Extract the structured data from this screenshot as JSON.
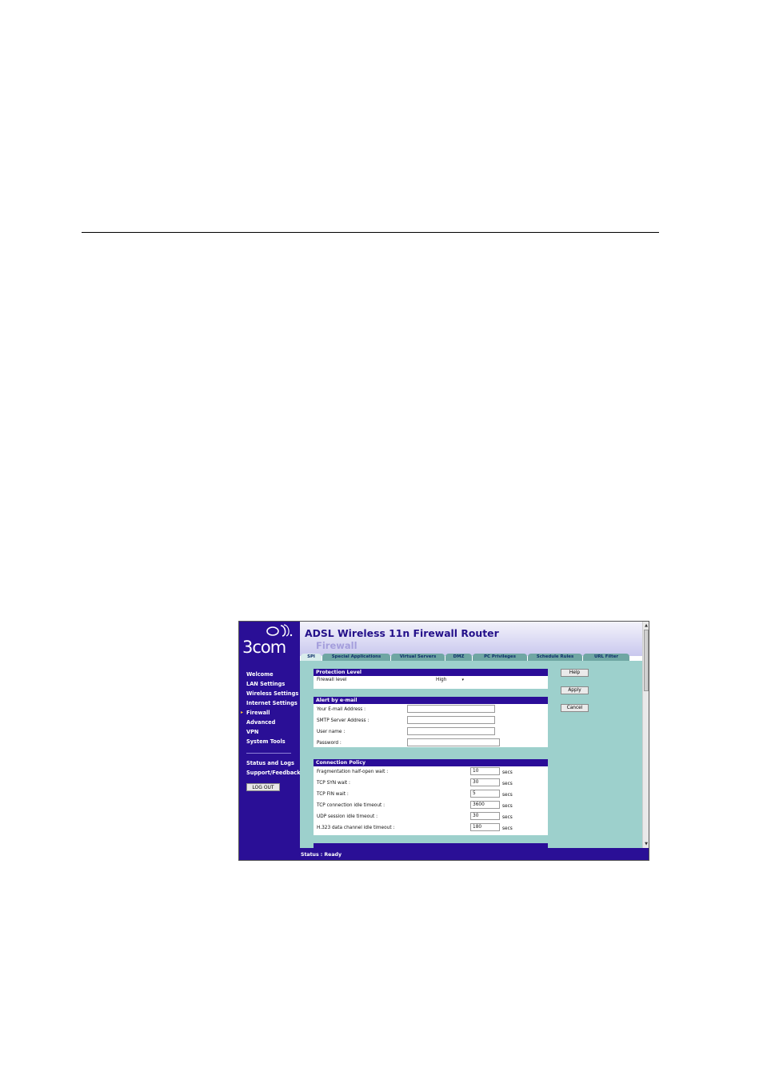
{
  "app": {
    "title": "ADSL Wireless 11n Firewall Router",
    "subtitle": "Firewall",
    "logo_text": "3com"
  },
  "sidebar": {
    "items": [
      {
        "label": "Welcome"
      },
      {
        "label": "LAN Settings"
      },
      {
        "label": "Wireless Settings"
      },
      {
        "label": "Internet Settings"
      },
      {
        "label": "Firewall",
        "active": true
      },
      {
        "label": "Advanced"
      },
      {
        "label": "VPN"
      },
      {
        "label": "System Tools"
      }
    ],
    "items2": [
      {
        "label": "Status and Logs"
      },
      {
        "label": "Support/Feedback"
      }
    ],
    "logout_label": "LOG OUT"
  },
  "tabs": [
    {
      "label": "SPI",
      "active": true
    },
    {
      "label": "Special Applications"
    },
    {
      "label": "Virtual Servers"
    },
    {
      "label": "DMZ"
    },
    {
      "label": "PC Privileges"
    },
    {
      "label": "Schedule Rules"
    },
    {
      "label": "URL Filter"
    }
  ],
  "protection": {
    "header": "Protection Level",
    "firewall_level_label": "Firewall level",
    "firewall_level_value": "High"
  },
  "alert": {
    "header": "Alert by e-mail",
    "email_label": "Your E-mail Address :",
    "smtp_label": "SMTP Server Address :",
    "username_label": "User name :",
    "password_label": "Password :"
  },
  "policy": {
    "header": "Connection Policy",
    "rows": [
      {
        "label": "Fragmentation half-open wait :",
        "value": "10",
        "unit": "secs"
      },
      {
        "label": "TCP SYN wait :",
        "value": "30",
        "unit": "secs"
      },
      {
        "label": "TCP FIN wait :",
        "value": "5",
        "unit": "secs"
      },
      {
        "label": "TCP connection idle timeout :",
        "value": "3600",
        "unit": "secs"
      },
      {
        "label": "UDP session idle timeout :",
        "value": "30",
        "unit": "secs"
      },
      {
        "label": "H.323 data channel idle timeout :",
        "value": "180",
        "unit": "secs"
      }
    ]
  },
  "buttons": {
    "help": "Help",
    "apply": "Apply",
    "cancel": "Cancel"
  },
  "status": {
    "text": "Status : Ready"
  }
}
